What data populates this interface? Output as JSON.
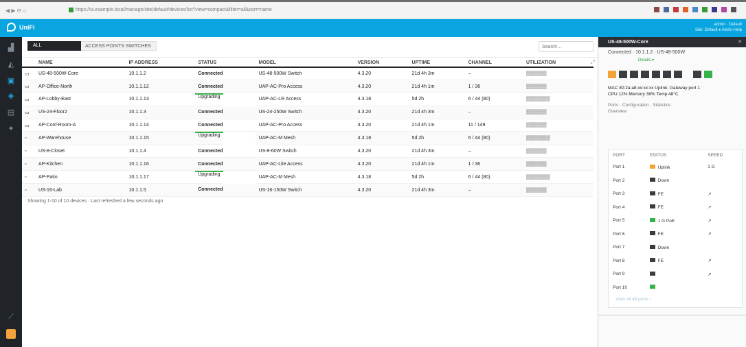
{
  "browser": {
    "nav": "◀ ▶ ⟳ ⌂",
    "url": "https://ui.example.local/manage/site/default/devices/list?view=compact&filter=all&sort=name",
    "extension_colors": [
      "#8a4a4a",
      "#4a6a9a",
      "#c63a3a",
      "#e0622a",
      "#4a8ac6",
      "#3a9a3a",
      "#3a3a8a",
      "#b04aa0",
      "#555555"
    ]
  },
  "header": {
    "title": "UniFi",
    "user_line1": "admin · Default",
    "user_line2": "Site: Default ▾  Alerts  Help"
  },
  "rail": {
    "items": [
      {
        "icon": "dashboard-icon",
        "glyph": "▟"
      },
      {
        "icon": "map-icon",
        "glyph": "◭"
      },
      {
        "icon": "devices-icon",
        "glyph": "▣"
      },
      {
        "icon": "clients-icon",
        "glyph": "◈"
      },
      {
        "icon": "stats-icon",
        "glyph": "▤"
      },
      {
        "icon": "insights-icon",
        "glyph": "✦"
      }
    ],
    "bottom_icon": "tools-icon"
  },
  "toolbar": {
    "tab_dark": "ALL",
    "tab_light": "ACCESS POINTS  SWITCHES",
    "search_placeholder": "Search…"
  },
  "table": {
    "headers": [
      "",
      "NAME",
      "IP ADDRESS",
      "STATUS",
      "MODEL",
      "VERSION",
      "UPTIME",
      "CHANNEL",
      "UTILIZATION"
    ],
    "rows": [
      {
        "sel": "▭",
        "name": "US-48-500W-Core",
        "ip": "10.1.1.2",
        "status": "Connected",
        "model": "US-48-500W Switch",
        "version": "4.3.20",
        "uptime": "21d 4h 3m",
        "channel": "–",
        "util": "▒▒▒▒▒▒"
      },
      {
        "sel": "▭",
        "name": "AP-Office-North",
        "ip": "10.1.1.12",
        "status": "Connected",
        "model": "UAP-AC-Pro Access",
        "version": "4.3.20",
        "uptime": "21d 4h 1m",
        "channel": "1 / 36",
        "util": "▒▒▒▒▒▒"
      },
      {
        "sel": "▭",
        "name": "AP-Lobby-East",
        "ip": "10.1.1.13",
        "status": "Upgrading",
        "model": "UAP-AC-LR Access",
        "version": "4.3.18",
        "uptime": "5d 2h",
        "channel": "6 / 44 (80)",
        "util": "▒▒▒▒▒▒▒"
      },
      {
        "sel": "▭",
        "name": "US-24-Floor2",
        "ip": "10.1.1.3",
        "status": "Connected",
        "model": "US-24-250W Switch",
        "version": "4.3.20",
        "uptime": "21d 4h 3m",
        "channel": "–",
        "util": "▒▒▒▒▒▒"
      },
      {
        "sel": "▭",
        "name": "AP-Conf-Room-A",
        "ip": "10.1.1.14",
        "status": "Connected",
        "model": "UAP-AC-Pro Access",
        "version": "4.3.20",
        "uptime": "21d 4h 1m",
        "channel": "11 / 149",
        "util": "▒▒▒▒▒▒"
      },
      {
        "sel": "▫",
        "name": "AP-Warehouse",
        "ip": "10.1.1.15",
        "status": "Upgrading",
        "model": "UAP-AC-M Mesh",
        "version": "4.3.18",
        "uptime": "5d 2h",
        "channel": "6 / 44 (80)",
        "util": "▒▒▒▒▒▒▒"
      },
      {
        "sel": "▫",
        "name": "US-8-Closet",
        "ip": "10.1.1.4",
        "status": "Connected",
        "model": "US-8-60W Switch",
        "version": "4.3.20",
        "uptime": "21d 4h 3m",
        "channel": "–",
        "util": "▒▒▒▒▒▒"
      },
      {
        "sel": "▫",
        "name": "AP-Kitchen",
        "ip": "10.1.1.16",
        "status": "Connected",
        "model": "UAP-AC-Lite Access",
        "version": "4.3.20",
        "uptime": "21d 4h 1m",
        "channel": "1 / 36",
        "util": "▒▒▒▒▒▒"
      },
      {
        "sel": "▫",
        "name": "AP-Patio",
        "ip": "10.1.1.17",
        "status": "Upgrading",
        "model": "UAP-AC-M Mesh",
        "version": "4.3.18",
        "uptime": "5d 2h",
        "channel": "6 / 44 (80)",
        "util": "▒▒▒▒▒▒▒"
      },
      {
        "sel": "▫",
        "name": "US-16-Lab",
        "ip": "10.1.1.5",
        "status": "Connected",
        "model": "US-16-150W Switch",
        "version": "4.3.20",
        "uptime": "21d 4h 3m",
        "channel": "–",
        "util": "▒▒▒▒▒▒"
      }
    ]
  },
  "footer_note": "Showing 1-10 of 10 devices  ·  Last refreshed a few seconds ago",
  "panel": {
    "title": "US-48-500W-Core",
    "sub": "Connected · 10.1.1.2 · US-48-500W",
    "sub_link": "Details ▾",
    "info_line1": "MAC 80:2a:a8:xx:xx:xx   Uplink: Gateway port 1",
    "info_line2": "CPU 12%   Memory 38%   Temp 48°C",
    "info2": "Ports  ·  Configuration  ·  Statistics",
    "info3": "Overview",
    "port_headers": [
      "PORT",
      "STATUS",
      "SPEED"
    ],
    "ports": [
      {
        "port": "Port 1",
        "dot": "w",
        "status": "Uplink",
        "speed": "1 G"
      },
      {
        "port": "Port 2",
        "dot": "d",
        "status": "Down",
        "speed": ""
      },
      {
        "port": "Port 3",
        "dot": "d",
        "status": "FE",
        "speed": "↗"
      },
      {
        "port": "Port 4",
        "dot": "d",
        "status": "FE",
        "speed": "↗"
      },
      {
        "port": "Port 5",
        "dot": "g",
        "status": "1 G PoE",
        "speed": "↗"
      },
      {
        "port": "Port 6",
        "dot": "d",
        "status": "FE",
        "speed": "↗"
      },
      {
        "port": "Port 7",
        "dot": "d",
        "status": "Down",
        "speed": ""
      },
      {
        "port": "Port 8",
        "dot": "d",
        "status": "FE",
        "speed": "↗"
      },
      {
        "port": "Port 9",
        "dot": "d",
        "status": "",
        "speed": "↗"
      },
      {
        "port": "Port 10",
        "dot": "g",
        "status": "",
        "speed": ""
      }
    ],
    "more": "View all 48 ports ›"
  }
}
